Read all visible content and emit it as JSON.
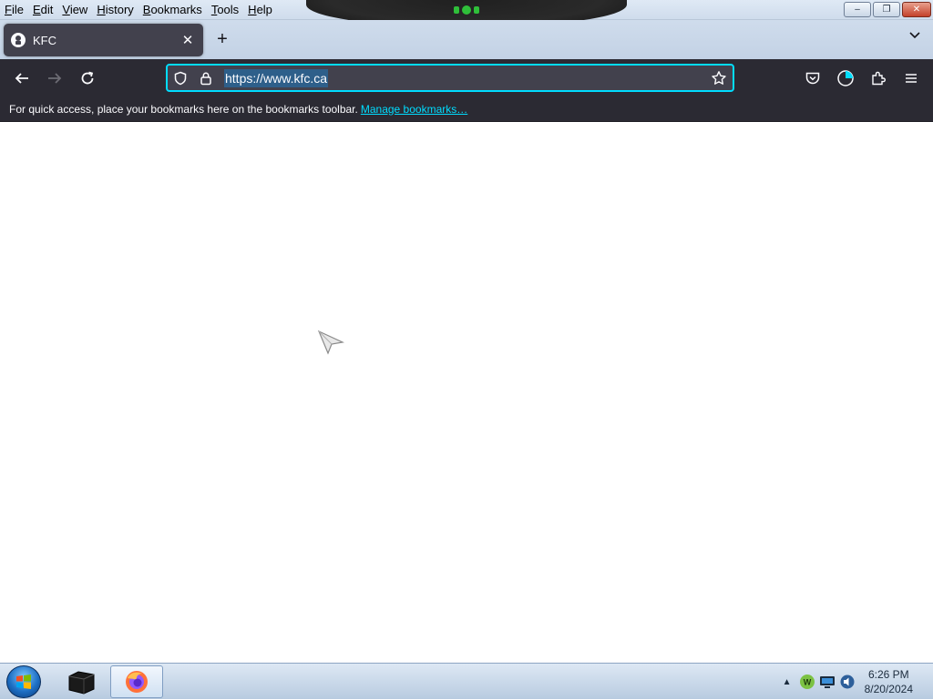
{
  "menu": [
    "File",
    "Edit",
    "View",
    "History",
    "Bookmarks",
    "Tools",
    "Help"
  ],
  "window_buttons": {
    "minimize": "–",
    "restore": "❐",
    "close": "✕"
  },
  "tab": {
    "title": "KFC",
    "close": "✕"
  },
  "tabstrip": {
    "new_tab": "+",
    "list_all_tabs": "⌄"
  },
  "navbar": {
    "back": "←",
    "forward": "→",
    "reload": "⟳",
    "url": "https://www.kfc.ca",
    "focus_color": "#00ddff"
  },
  "bookmarks_bar": {
    "text": "For quick access, place your bookmarks here on the bookmarks toolbar.",
    "link": "Manage bookmarks…"
  },
  "taskbar": {
    "clock_time": "6:26 PM",
    "clock_date": "8/20/2024",
    "tray_expand": "▲",
    "tray_w_label": "W"
  },
  "icons": [
    "shield-icon",
    "lock-icon",
    "star-icon",
    "pocket-icon",
    "account-icon",
    "extensions-icon",
    "hamburger-menu-icon"
  ]
}
